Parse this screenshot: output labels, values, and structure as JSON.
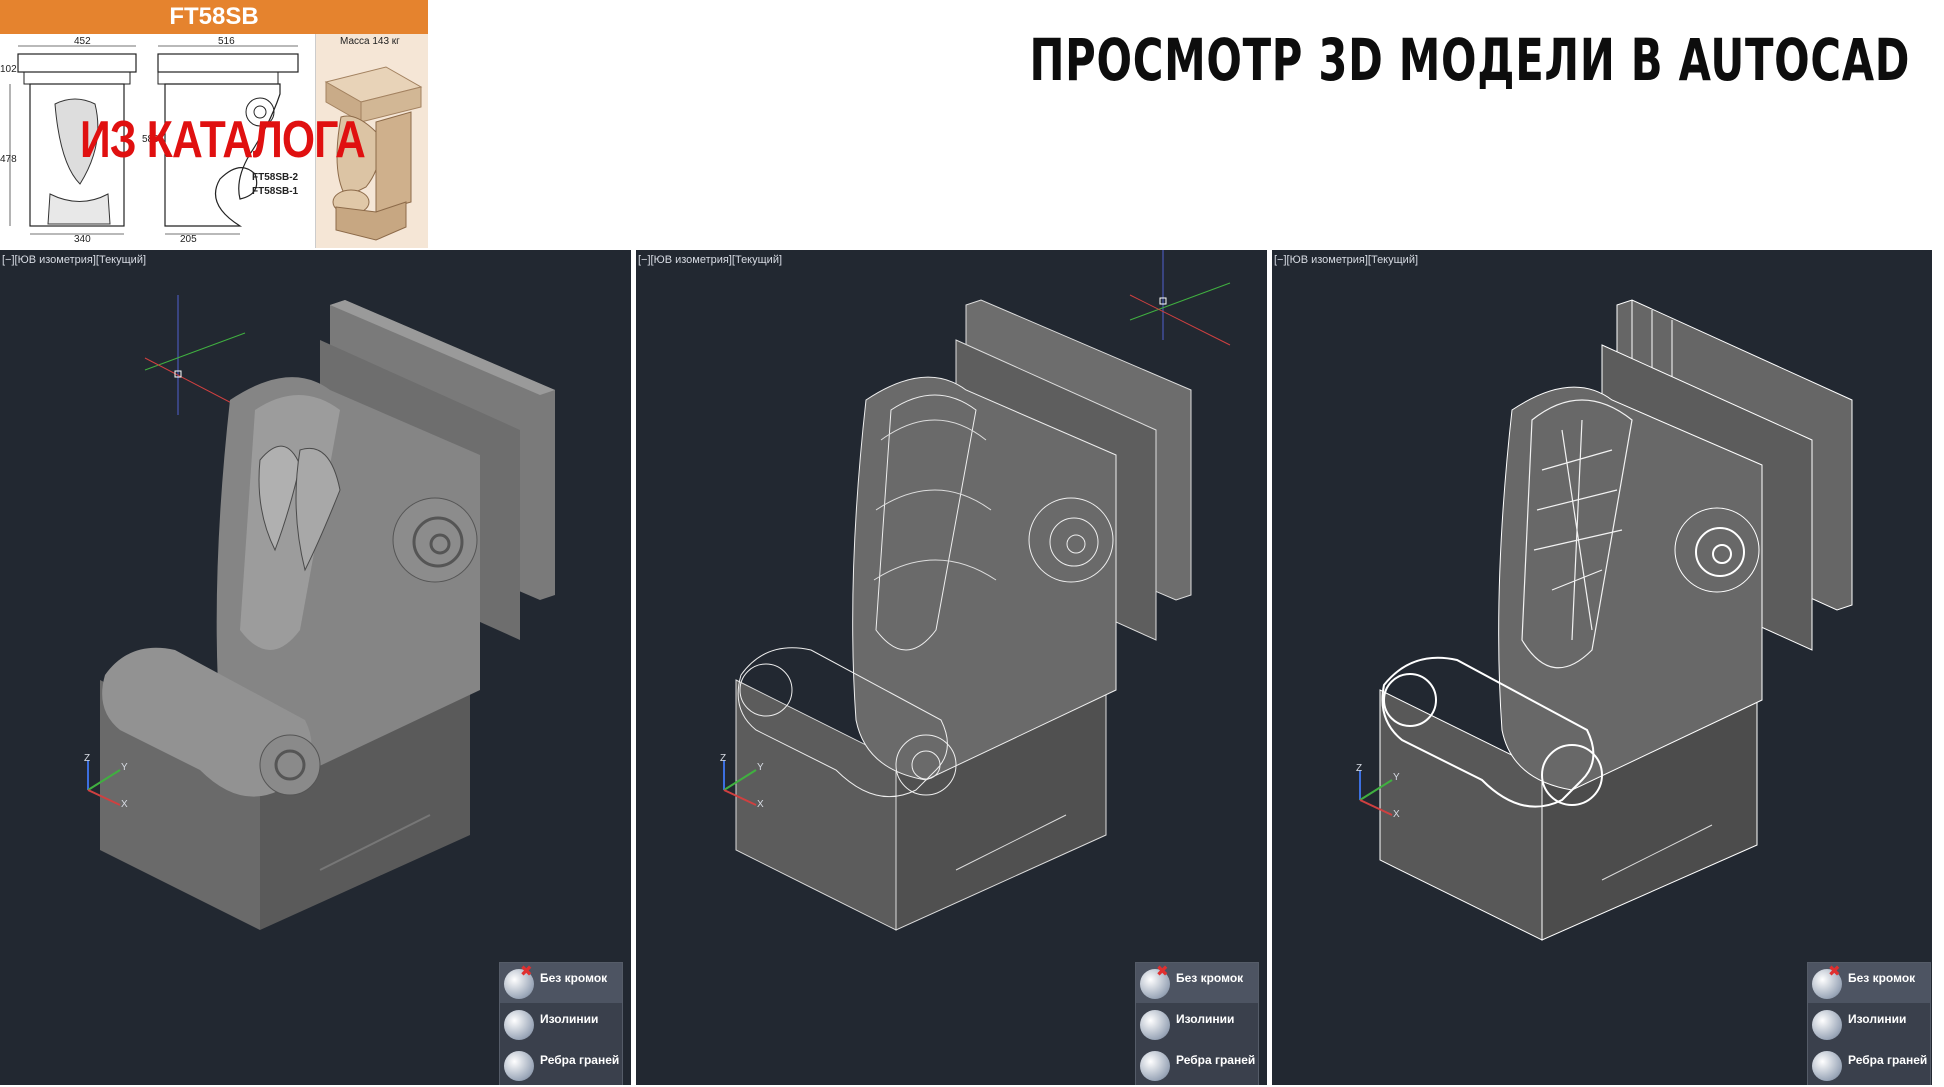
{
  "title": "ПРОСМОТР 3D МОДЕЛИ В AUTOCAD",
  "catalog": {
    "code": "FT58SB",
    "weight": "Масса 143 кг",
    "stamp": "ИЗ КАТАЛОГА",
    "dims": [
      "452",
      "516",
      "102",
      "478",
      "580",
      "340",
      "205"
    ],
    "variants": [
      "FT58SB-2",
      "FT58SB-1"
    ]
  },
  "viewports": [
    {
      "label": "[−][ЮВ изометрия][Текущий]",
      "style": "shaded"
    },
    {
      "label": "[−][ЮВ изометрия][Текущий]",
      "style": "isolines"
    },
    {
      "label": "[−][ЮВ изометрия][Текущий]",
      "style": "edges"
    }
  ],
  "visual_styles": [
    {
      "label": "Без кромок",
      "icon": "no-edges-icon"
    },
    {
      "label": "Изолинии",
      "icon": "isolines-icon"
    },
    {
      "label": "Ребра граней",
      "icon": "facet-edges-icon"
    }
  ],
  "axes": {
    "x": "X",
    "y": "Y",
    "z": "Z"
  },
  "colors": {
    "viewport_bg": "#222831",
    "catalog_header": "#e5832e",
    "stamp": "#e01010"
  }
}
